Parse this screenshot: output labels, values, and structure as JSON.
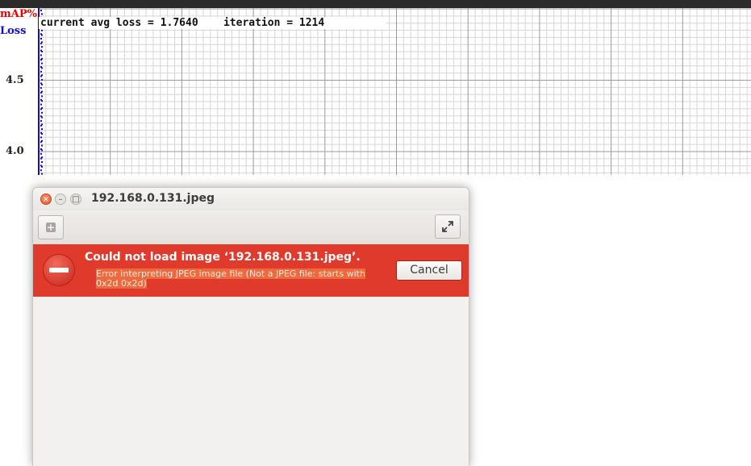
{
  "chart": {
    "map_label": "mAP%",
    "loss_label": "Loss",
    "y_ticks": [
      "4.5",
      "4.0"
    ],
    "status": "current avg loss = 1.7640    iteration = 1214"
  },
  "window": {
    "title": "192.168.0.131.jpeg",
    "close_glyph": "×",
    "minimize_glyph": "–",
    "maximize_glyph": "□"
  },
  "infobar": {
    "title": "Could not load image ‘192.168.0.131.jpeg’.",
    "detail": "Error interpreting JPEG image file (Not a JPEG file: starts with 0x2d 0x2d)",
    "cancel_label": "Cancel"
  },
  "colors": {
    "infobar_bg": "#df3a2b",
    "map_color": "#e00000",
    "loss_color": "#1010c0"
  },
  "icons": {
    "toolbar_left": "add-icon",
    "toolbar_right": "fullscreen-icon",
    "error": "error-icon"
  }
}
